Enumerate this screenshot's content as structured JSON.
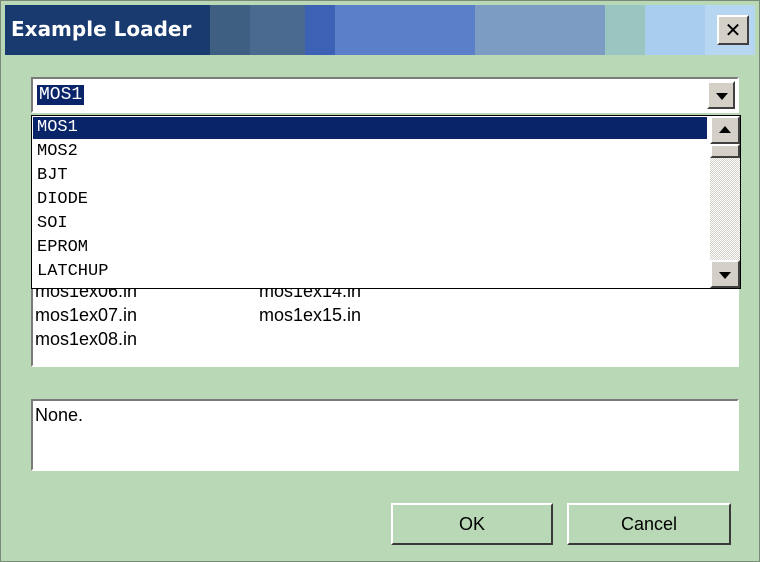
{
  "window": {
    "title": "Example Loader",
    "close_label": "✕"
  },
  "category_combo": {
    "value": "MOS1"
  },
  "category_dropdown": {
    "items": [
      "MOS1",
      "MOS2",
      "BJT",
      "DIODE",
      "SOI",
      "EPROM",
      "LATCHUP"
    ],
    "selected_index": 0
  },
  "file_list": {
    "column1": [
      "mos1ex06.in",
      "mos1ex07.in",
      "mos1ex08.in"
    ],
    "column2": [
      "mos1ex14.in",
      "mos1ex15.in"
    ]
  },
  "description": {
    "text": "None."
  },
  "buttons": {
    "ok": "OK",
    "cancel": "Cancel"
  }
}
